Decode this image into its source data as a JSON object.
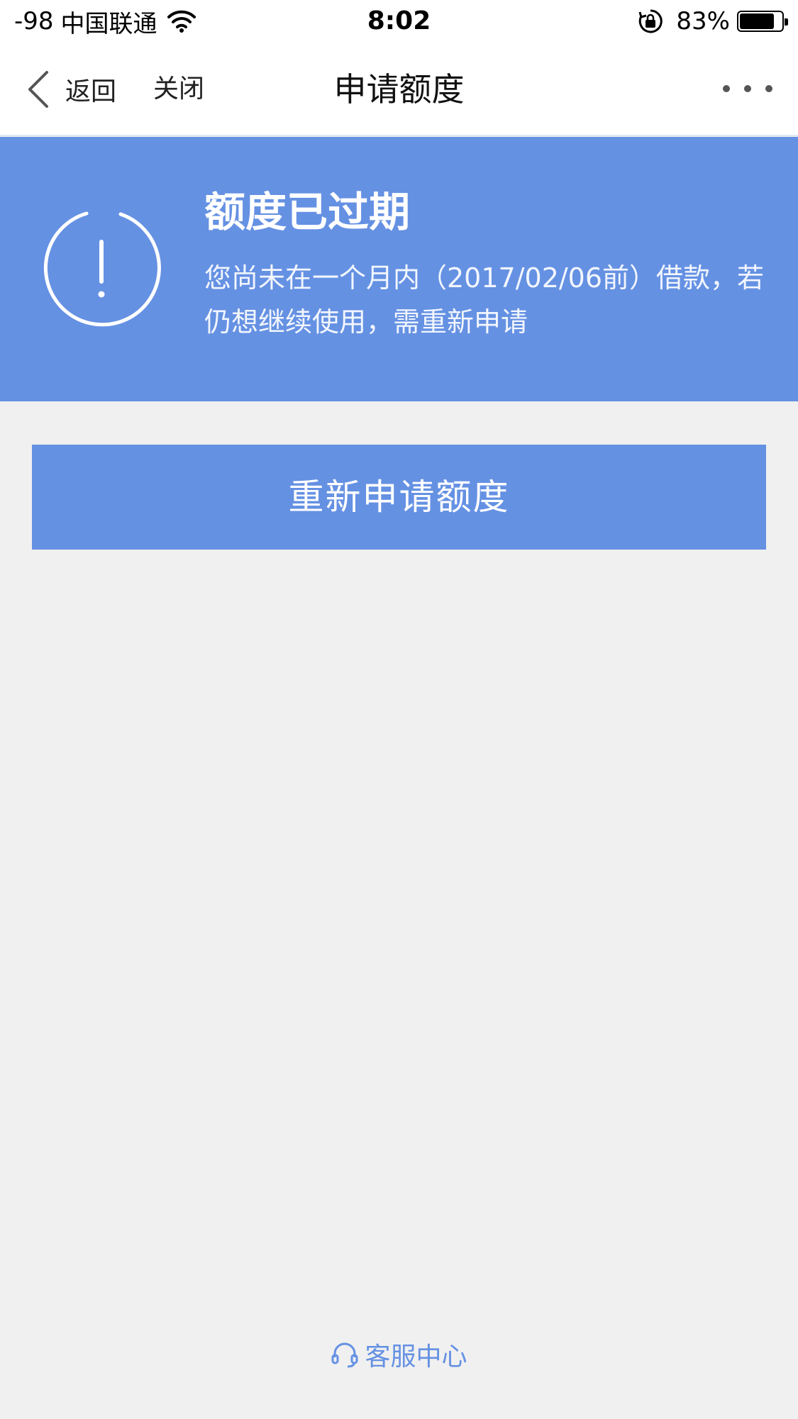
{
  "status_bar": {
    "signal": "-98",
    "carrier": "中国联通",
    "time": "8:02",
    "battery_percent": "83%",
    "battery_level": 0.83
  },
  "nav": {
    "back_label": "返回",
    "close_label": "关闭",
    "title": "申请额度"
  },
  "banner": {
    "title": "额度已过期",
    "description": "您尚未在一个月内（2017/02/06前）借款，若仍想继续使用，需重新申请",
    "background_color": "#6591e3"
  },
  "actions": {
    "reapply_label": "重新申请额度"
  },
  "footer": {
    "service_label": "客服中心",
    "link_color": "#6591e3"
  },
  "icons": [
    "wifi-icon",
    "orientation-lock-icon",
    "battery-icon",
    "back-chevron-icon",
    "more-icon",
    "alert-icon",
    "headset-icon"
  ]
}
